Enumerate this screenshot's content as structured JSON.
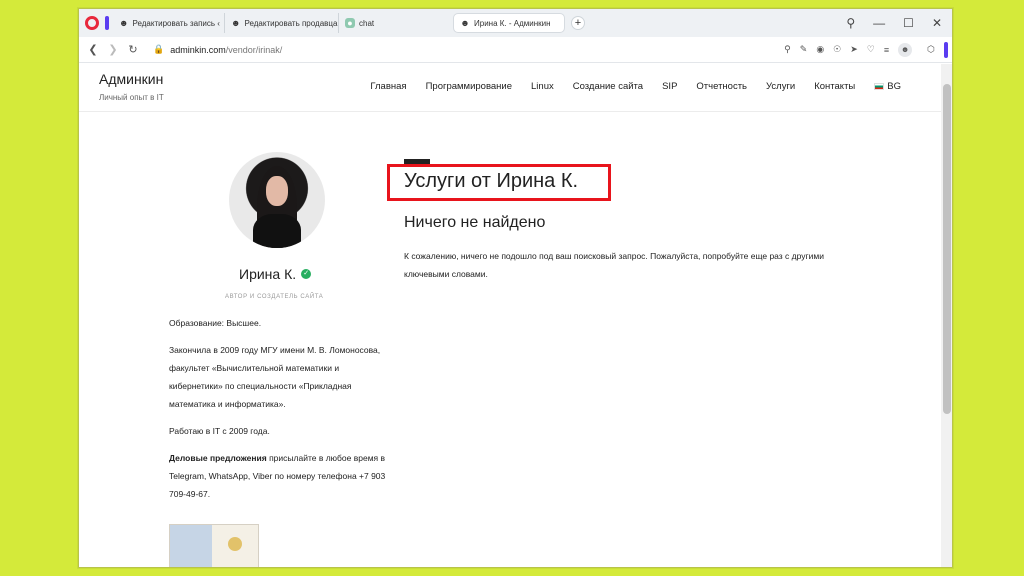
{
  "browser": {
    "tabs": [
      {
        "label": "Редактировать запись ‹",
        "icon": "user-icon",
        "active": false
      },
      {
        "label": "Редактировать продавца",
        "icon": "user-icon",
        "active": false
      },
      {
        "label": "chat",
        "icon": "chat-icon",
        "active": false
      },
      {
        "label": "Ирина К. - Админкин",
        "icon": "user-icon",
        "active": true
      }
    ],
    "url_host": "adminkin.com",
    "url_path": "/vendor/irinak/"
  },
  "site": {
    "title": "Админкин",
    "subtitle": "Личный опыт в IT",
    "menu": [
      "Главная",
      "Программирование",
      "Linux",
      "Создание сайта",
      "SIP",
      "Отчетность",
      "Услуги",
      "Контакты"
    ],
    "lang": "BG"
  },
  "author": {
    "name": "Ирина К.",
    "role": "АВТОР И СОЗДАТЕЛЬ САЙТА",
    "education": "Образование: Высшее.",
    "bio1": "Закончила в 2009 году МГУ имени М. В. Ломоносова, факультет «Вычислительной математики и кибернетики» по специальности «Прикладная математика и информатика».",
    "bio2": "Работаю в IT с 2009 года.",
    "offer_bold": "Деловые предложения",
    "offer_rest": " присылайте в любое время в Telegram, WhatsApp, Viber по номеру телефона +7 903 709-49-67."
  },
  "main": {
    "title": "Услуги от Ирина К.",
    "subtitle": "Ничего не найдено",
    "message": "К сожалению, ничего не подошло под ваш поисковый запрос. Пожалуйста, попробуйте еще раз с другими ключевыми словами."
  }
}
